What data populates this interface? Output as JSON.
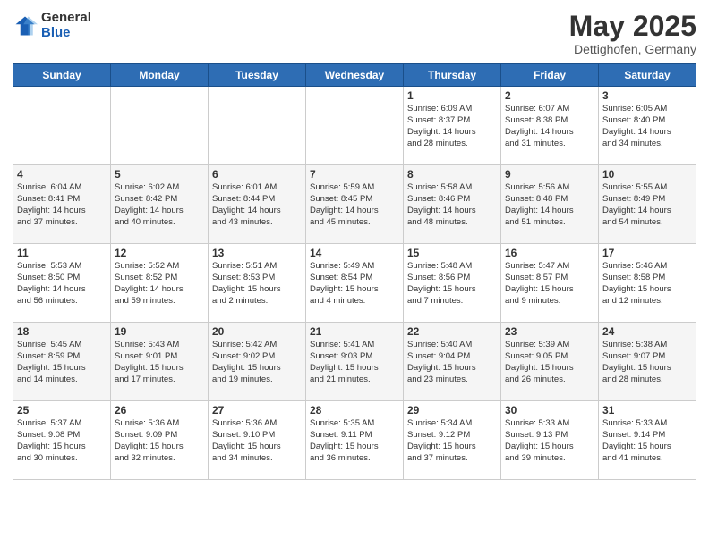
{
  "header": {
    "logo_general": "General",
    "logo_blue": "Blue",
    "title": "May 2025",
    "subtitle": "Dettighofen, Germany"
  },
  "weekdays": [
    "Sunday",
    "Monday",
    "Tuesday",
    "Wednesday",
    "Thursday",
    "Friday",
    "Saturday"
  ],
  "weeks": [
    [
      {
        "day": "",
        "info": ""
      },
      {
        "day": "",
        "info": ""
      },
      {
        "day": "",
        "info": ""
      },
      {
        "day": "",
        "info": ""
      },
      {
        "day": "1",
        "info": "Sunrise: 6:09 AM\nSunset: 8:37 PM\nDaylight: 14 hours\nand 28 minutes."
      },
      {
        "day": "2",
        "info": "Sunrise: 6:07 AM\nSunset: 8:38 PM\nDaylight: 14 hours\nand 31 minutes."
      },
      {
        "day": "3",
        "info": "Sunrise: 6:05 AM\nSunset: 8:40 PM\nDaylight: 14 hours\nand 34 minutes."
      }
    ],
    [
      {
        "day": "4",
        "info": "Sunrise: 6:04 AM\nSunset: 8:41 PM\nDaylight: 14 hours\nand 37 minutes."
      },
      {
        "day": "5",
        "info": "Sunrise: 6:02 AM\nSunset: 8:42 PM\nDaylight: 14 hours\nand 40 minutes."
      },
      {
        "day": "6",
        "info": "Sunrise: 6:01 AM\nSunset: 8:44 PM\nDaylight: 14 hours\nand 43 minutes."
      },
      {
        "day": "7",
        "info": "Sunrise: 5:59 AM\nSunset: 8:45 PM\nDaylight: 14 hours\nand 45 minutes."
      },
      {
        "day": "8",
        "info": "Sunrise: 5:58 AM\nSunset: 8:46 PM\nDaylight: 14 hours\nand 48 minutes."
      },
      {
        "day": "9",
        "info": "Sunrise: 5:56 AM\nSunset: 8:48 PM\nDaylight: 14 hours\nand 51 minutes."
      },
      {
        "day": "10",
        "info": "Sunrise: 5:55 AM\nSunset: 8:49 PM\nDaylight: 14 hours\nand 54 minutes."
      }
    ],
    [
      {
        "day": "11",
        "info": "Sunrise: 5:53 AM\nSunset: 8:50 PM\nDaylight: 14 hours\nand 56 minutes."
      },
      {
        "day": "12",
        "info": "Sunrise: 5:52 AM\nSunset: 8:52 PM\nDaylight: 14 hours\nand 59 minutes."
      },
      {
        "day": "13",
        "info": "Sunrise: 5:51 AM\nSunset: 8:53 PM\nDaylight: 15 hours\nand 2 minutes."
      },
      {
        "day": "14",
        "info": "Sunrise: 5:49 AM\nSunset: 8:54 PM\nDaylight: 15 hours\nand 4 minutes."
      },
      {
        "day": "15",
        "info": "Sunrise: 5:48 AM\nSunset: 8:56 PM\nDaylight: 15 hours\nand 7 minutes."
      },
      {
        "day": "16",
        "info": "Sunrise: 5:47 AM\nSunset: 8:57 PM\nDaylight: 15 hours\nand 9 minutes."
      },
      {
        "day": "17",
        "info": "Sunrise: 5:46 AM\nSunset: 8:58 PM\nDaylight: 15 hours\nand 12 minutes."
      }
    ],
    [
      {
        "day": "18",
        "info": "Sunrise: 5:45 AM\nSunset: 8:59 PM\nDaylight: 15 hours\nand 14 minutes."
      },
      {
        "day": "19",
        "info": "Sunrise: 5:43 AM\nSunset: 9:01 PM\nDaylight: 15 hours\nand 17 minutes."
      },
      {
        "day": "20",
        "info": "Sunrise: 5:42 AM\nSunset: 9:02 PM\nDaylight: 15 hours\nand 19 minutes."
      },
      {
        "day": "21",
        "info": "Sunrise: 5:41 AM\nSunset: 9:03 PM\nDaylight: 15 hours\nand 21 minutes."
      },
      {
        "day": "22",
        "info": "Sunrise: 5:40 AM\nSunset: 9:04 PM\nDaylight: 15 hours\nand 23 minutes."
      },
      {
        "day": "23",
        "info": "Sunrise: 5:39 AM\nSunset: 9:05 PM\nDaylight: 15 hours\nand 26 minutes."
      },
      {
        "day": "24",
        "info": "Sunrise: 5:38 AM\nSunset: 9:07 PM\nDaylight: 15 hours\nand 28 minutes."
      }
    ],
    [
      {
        "day": "25",
        "info": "Sunrise: 5:37 AM\nSunset: 9:08 PM\nDaylight: 15 hours\nand 30 minutes."
      },
      {
        "day": "26",
        "info": "Sunrise: 5:36 AM\nSunset: 9:09 PM\nDaylight: 15 hours\nand 32 minutes."
      },
      {
        "day": "27",
        "info": "Sunrise: 5:36 AM\nSunset: 9:10 PM\nDaylight: 15 hours\nand 34 minutes."
      },
      {
        "day": "28",
        "info": "Sunrise: 5:35 AM\nSunset: 9:11 PM\nDaylight: 15 hours\nand 36 minutes."
      },
      {
        "day": "29",
        "info": "Sunrise: 5:34 AM\nSunset: 9:12 PM\nDaylight: 15 hours\nand 37 minutes."
      },
      {
        "day": "30",
        "info": "Sunrise: 5:33 AM\nSunset: 9:13 PM\nDaylight: 15 hours\nand 39 minutes."
      },
      {
        "day": "31",
        "info": "Sunrise: 5:33 AM\nSunset: 9:14 PM\nDaylight: 15 hours\nand 41 minutes."
      }
    ]
  ]
}
